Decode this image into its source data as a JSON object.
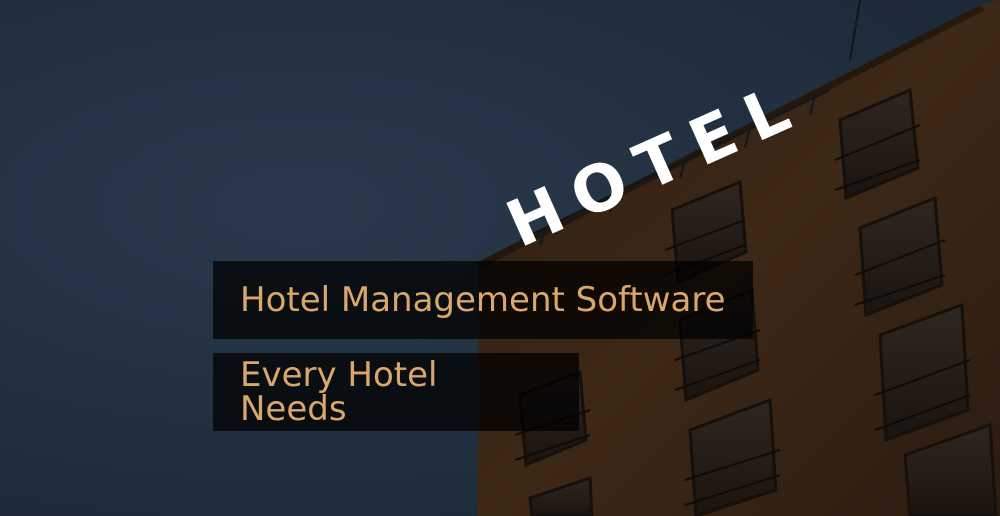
{
  "image": {
    "sign_text": "HOTEL",
    "colors": {
      "sky": "#223142",
      "building": "#3a2616",
      "caption_background": "#000000",
      "caption_text": "#d9a66c",
      "sign_letters": "#ffffff"
    }
  },
  "caption": {
    "line1": "Hotel Management Software",
    "line2": "Every Hotel Needs"
  }
}
